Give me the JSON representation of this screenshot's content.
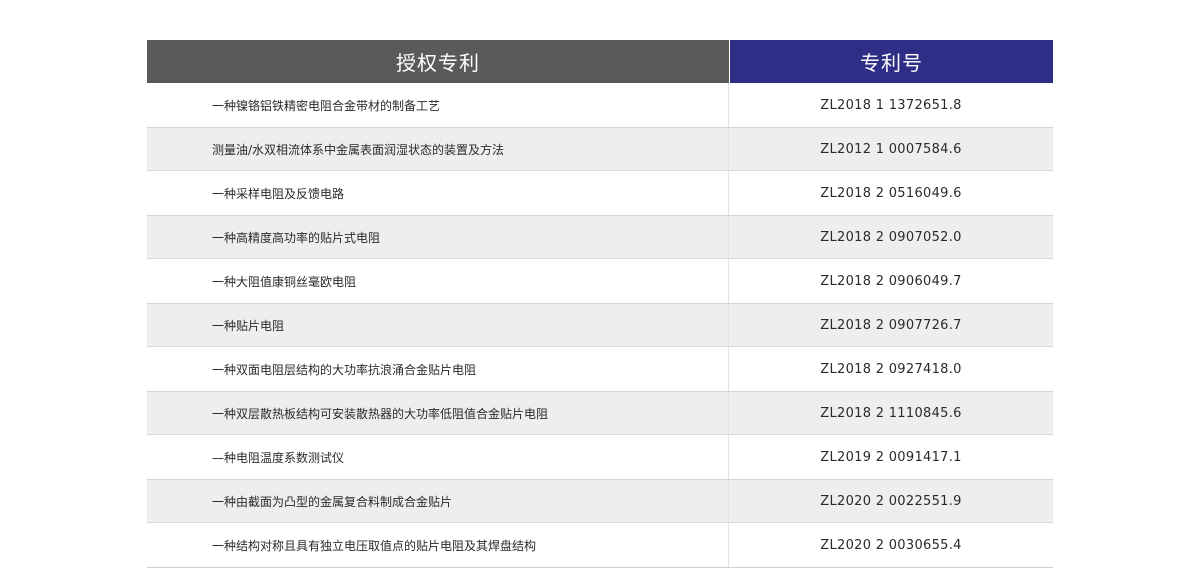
{
  "header": {
    "col_patent": "授权专利",
    "col_number": "专利号"
  },
  "rows": [
    {
      "name": "一种镍铬铝铁精密电阻合金带材的制备工艺",
      "number": "ZL2018 1 1372651.8"
    },
    {
      "name": "测量油/水双相流体系中金属表面润湿状态的装置及方法",
      "number": "ZL2012 1 0007584.6"
    },
    {
      "name": "一种采样电阻及反馈电路",
      "number": "ZL2018 2 0516049.6"
    },
    {
      "name": "一种高精度高功率的贴片式电阻",
      "number": "ZL2018 2 0907052.0"
    },
    {
      "name": "一种大阻值康铜丝毫欧电阻",
      "number": "ZL2018 2 0906049.7"
    },
    {
      "name": "一种贴片电阻",
      "number": "ZL2018 2 0907726.7"
    },
    {
      "name": "一种双面电阻层结构的大功率抗浪涌合金贴片电阻",
      "number": "ZL2018 2 0927418.0"
    },
    {
      "name": "一种双层散热板结构可安装散热器的大功率低阻值合金贴片电阻",
      "number": "ZL2018 2 1110845.6"
    },
    {
      "name": "—种电阻温度系数测试仪",
      "number": "ZL2019 2 0091417.1"
    },
    {
      "name": "一种由截面为凸型的金属复合料制成合金贴片",
      "number": "ZL2020 2 0022551.9"
    },
    {
      "name": "一种结构对称且具有独立电压取值点的贴片电阻及其焊盘结构",
      "number": "ZL2020 2 0030655.4"
    }
  ]
}
